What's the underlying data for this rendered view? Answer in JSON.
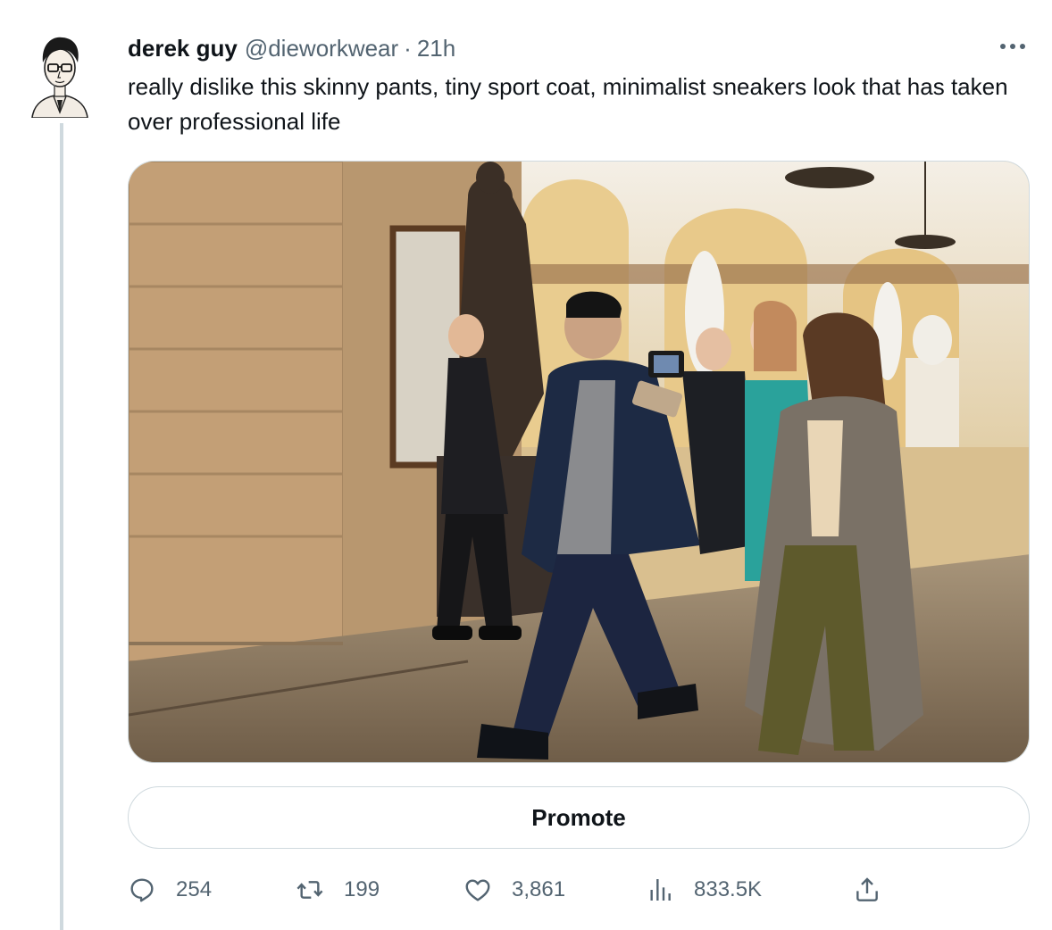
{
  "tweet": {
    "author_name": "derek guy",
    "author_handle": "@dieworkwear",
    "separator": "·",
    "time": "21h",
    "text": "really dislike this skinny pants, tiny sport coat, minimalist sneakers look that has taken over professional life",
    "media_icon": "photo"
  },
  "promote": {
    "label": "Promote"
  },
  "actions": {
    "replies": {
      "icon": "reply-icon",
      "count": "254"
    },
    "retweets": {
      "icon": "retweet-icon",
      "count": "199"
    },
    "likes": {
      "icon": "heart-icon",
      "count": "3,861"
    },
    "views": {
      "icon": "analytics-icon",
      "count": "833.5K"
    },
    "share": {
      "icon": "share-icon"
    }
  },
  "colors": {
    "text_primary": "#0f1419",
    "text_secondary": "#536471",
    "border": "#cfd9de"
  }
}
